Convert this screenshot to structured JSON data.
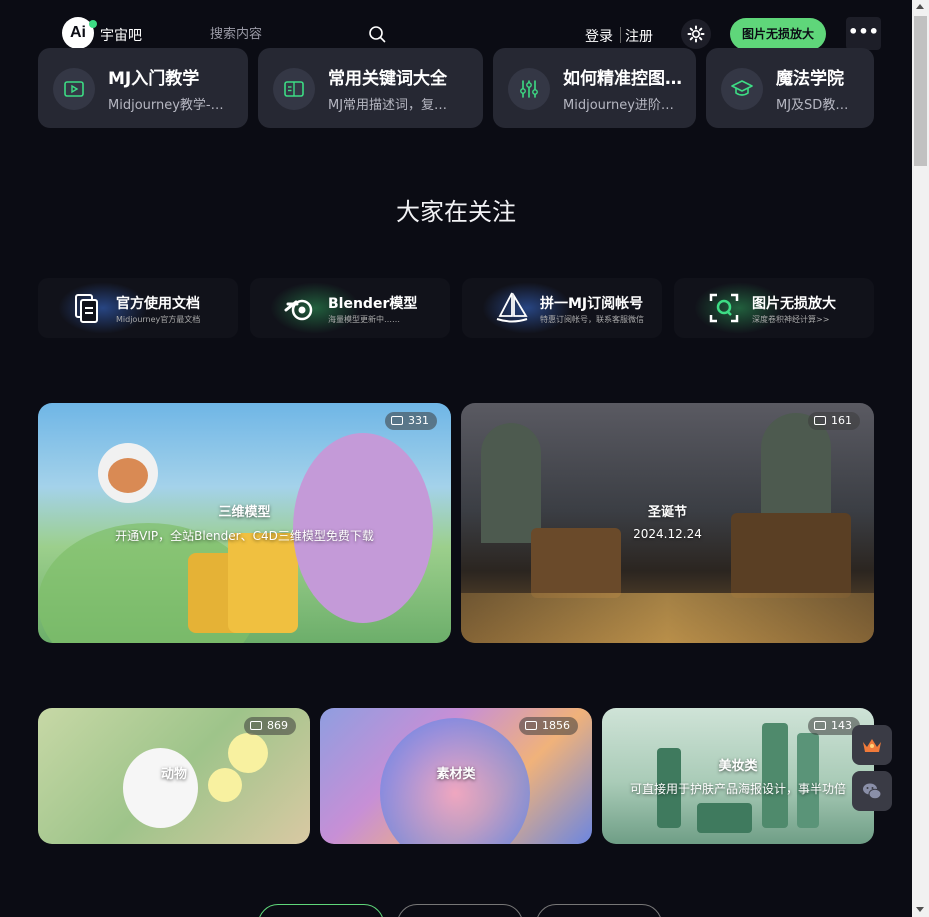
{
  "header": {
    "logo_text": "Ai",
    "site_name": "宇宙吧",
    "search_placeholder": "搜索内容",
    "login": "登录",
    "register": "注册",
    "upscale_button": "图片无损放大",
    "more": "•••"
  },
  "quick_links": [
    {
      "title": "MJ入门教学",
      "subtitle": "Midjourney教学-…",
      "icon": "video-icon"
    },
    {
      "title": "常用关键词大全",
      "subtitle": "MJ常用描述词，复…",
      "icon": "book-icon"
    },
    {
      "title": "如何精准控图…",
      "subtitle": "Midjourney进阶…",
      "icon": "sliders-icon"
    },
    {
      "title": "魔法学院",
      "subtitle": "MJ及SD教…",
      "icon": "graduation-cap-icon"
    }
  ],
  "section_title": "大家在关注",
  "features": [
    {
      "title": "官方使用文档",
      "subtitle": "Midjourney官方最文档",
      "icon": "document-icon",
      "glow": "#3a6fd8"
    },
    {
      "title": "Blender模型",
      "subtitle": "海量模型更新中……",
      "icon": "blender-icon",
      "glow": "#2f9f5a"
    },
    {
      "title": "拼一MJ订阅帐号",
      "subtitle": "特惠订阅帐号，联系客服微信",
      "icon": "sailboat-icon",
      "glow": "#3a6fd8"
    },
    {
      "title": "图片无损放大",
      "subtitle": "深度卷积神经计算>>",
      "icon": "scan-q-icon",
      "glow": "#2f9f5a"
    }
  ],
  "categories_large": [
    {
      "title": "三维模型",
      "subtitle": "开通VIP，全站Blender、C4D三维模型免费下载",
      "count": "331"
    },
    {
      "title": "圣诞节",
      "subtitle": "2024.12.24",
      "count": "161"
    }
  ],
  "categories_small": [
    {
      "title": "动物",
      "subtitle": "",
      "count": "869"
    },
    {
      "title": "素材类",
      "subtitle": "",
      "count": "1856"
    },
    {
      "title": "美妆类",
      "subtitle": "可直接用于护肤产品海报设计，事半功倍",
      "count": "143"
    }
  ],
  "floating": {
    "vip_icon": "crown-icon",
    "wechat_icon": "wechat-icon"
  },
  "colors": {
    "accent": "#5fd67a",
    "background": "#0b0c14",
    "card": "#262833"
  }
}
